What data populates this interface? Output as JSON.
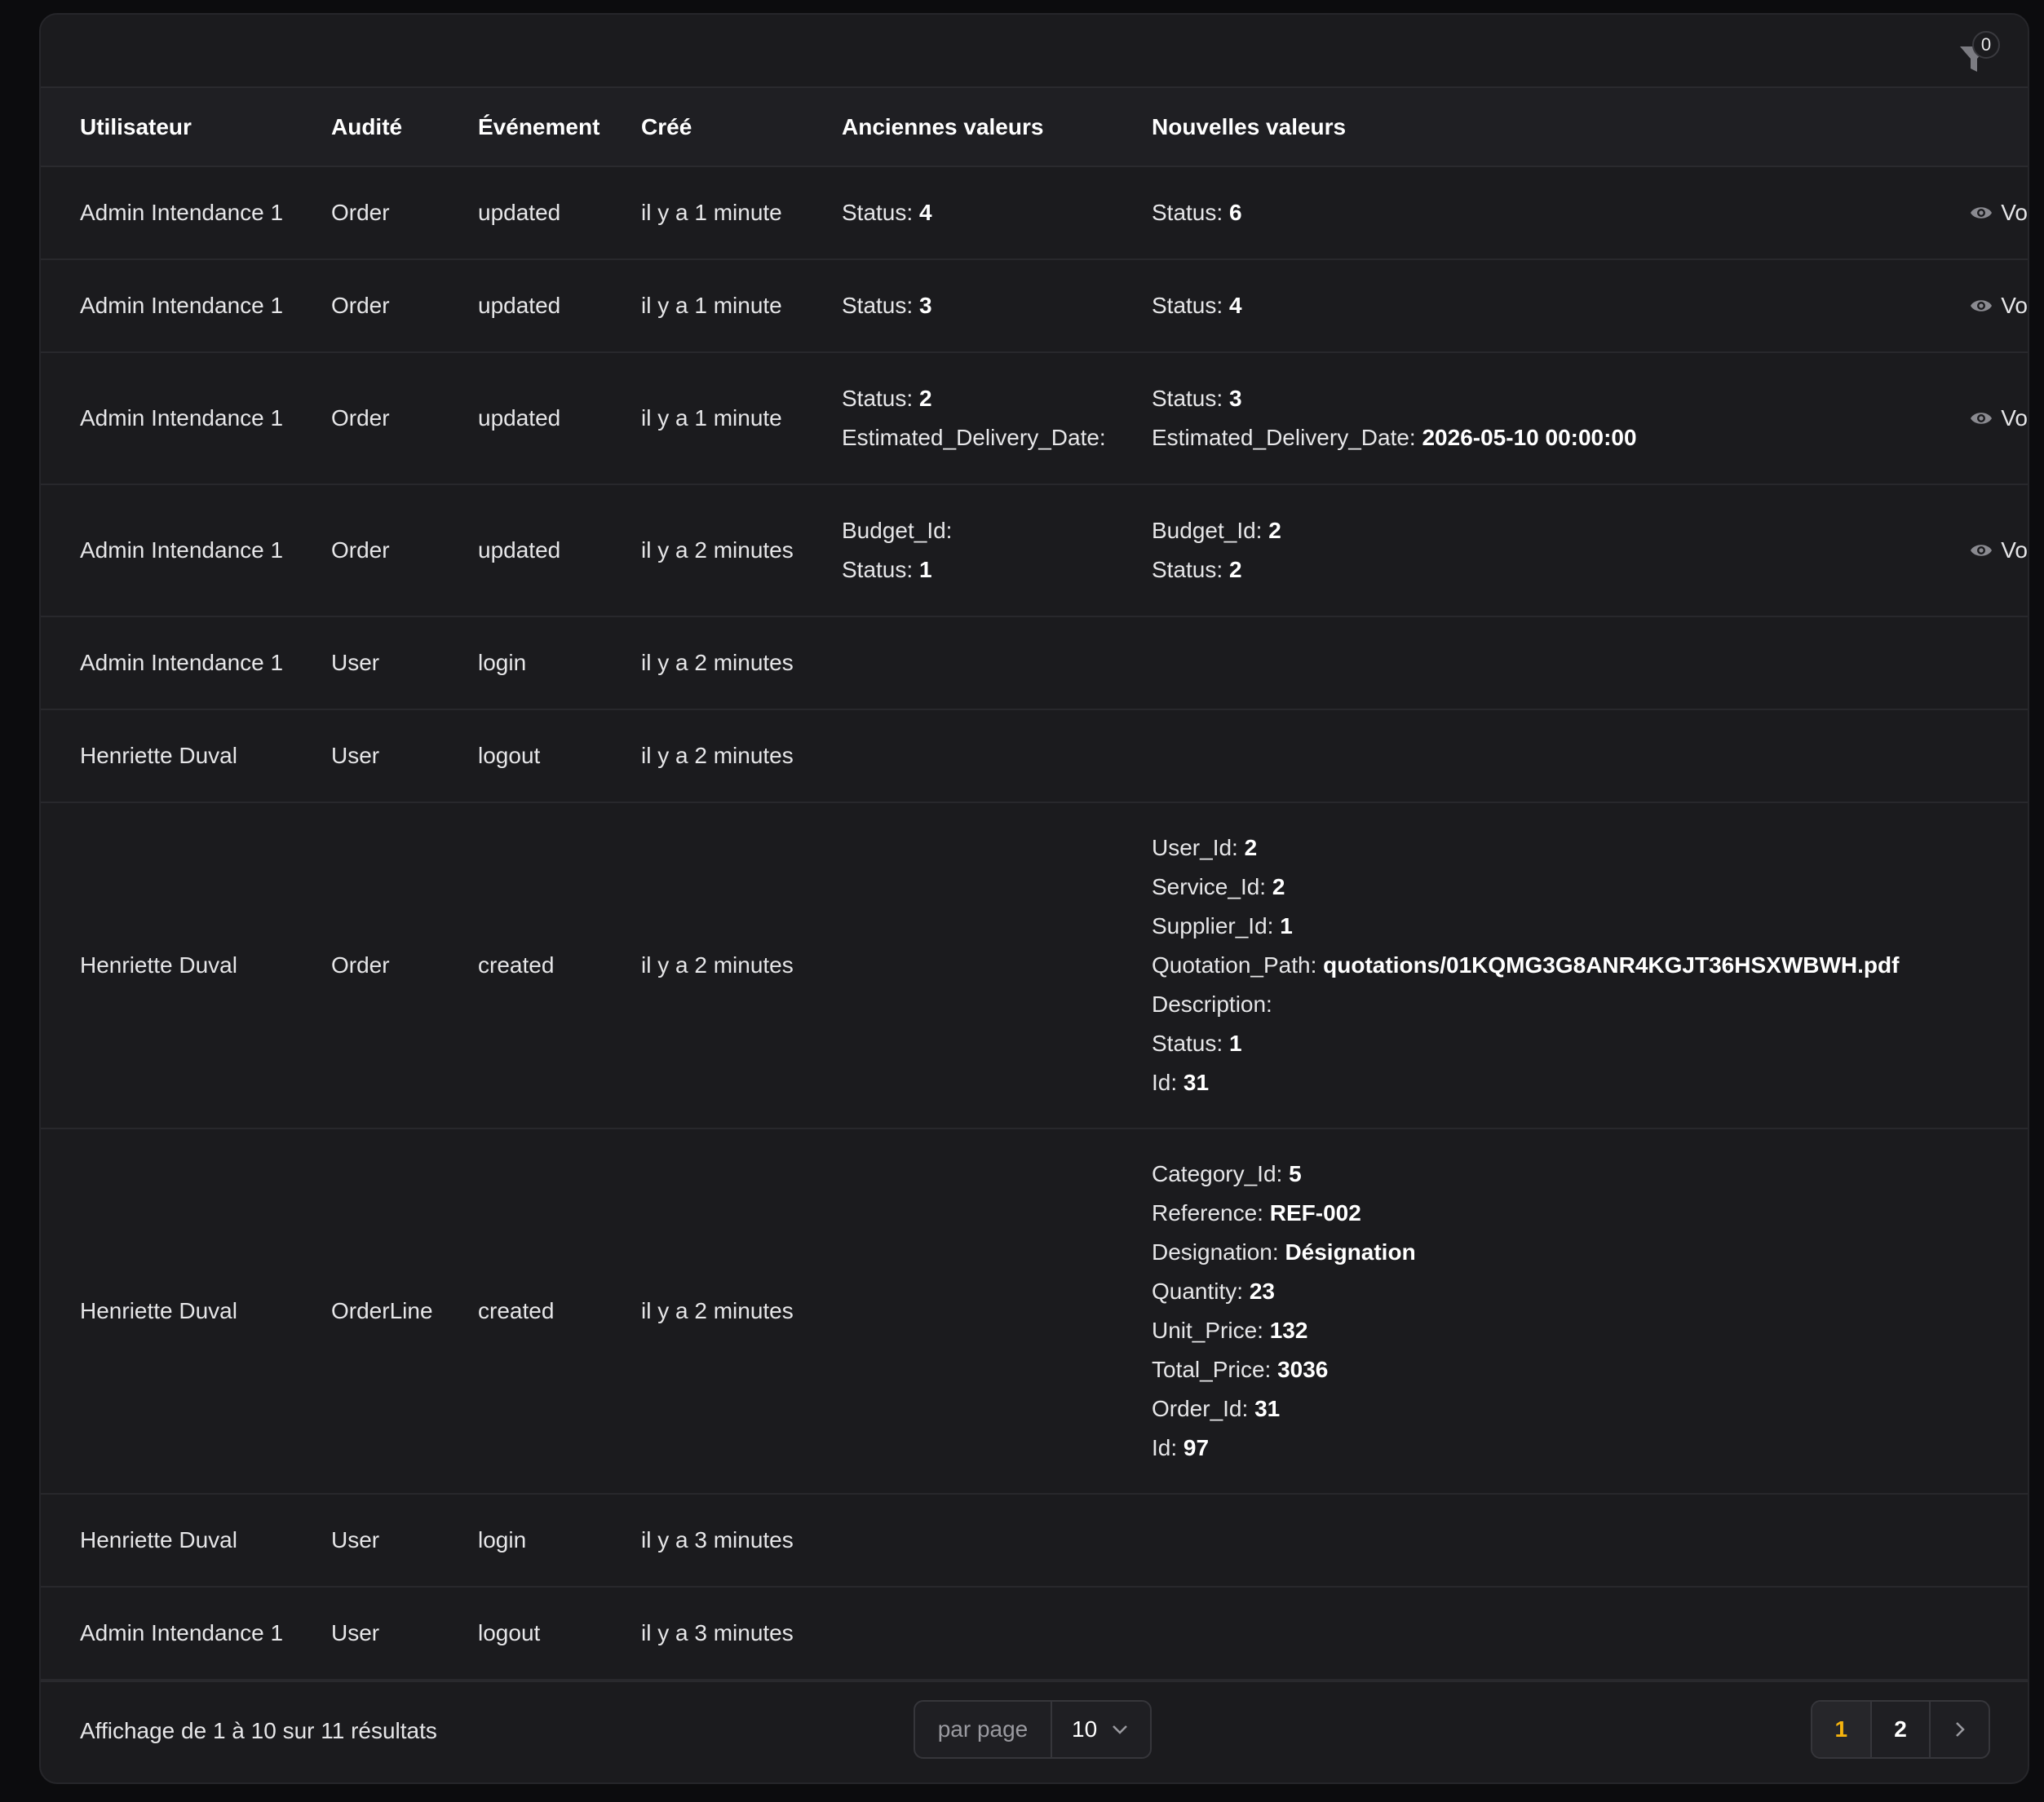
{
  "colors": {
    "accent": "#f5b30e",
    "background": "#1b1b1e",
    "header": "#1f1f23"
  },
  "filter": {
    "icon": "filter-icon",
    "count": "0"
  },
  "columns": [
    "Utilisateur",
    "Audité",
    "Événement",
    "Créé",
    "Anciennes valeurs",
    "Nouvelles valeurs"
  ],
  "view_label": "Vo",
  "rows": [
    {
      "user": "Admin Intendance 1",
      "audited": "Order",
      "event": "updated",
      "created": "il y a 1 minute",
      "old": [
        {
          "k": "Status:",
          "v": "4"
        }
      ],
      "new": [
        {
          "k": "Status:",
          "v": "6"
        }
      ],
      "view": true
    },
    {
      "user": "Admin Intendance 1",
      "audited": "Order",
      "event": "updated",
      "created": "il y a 1 minute",
      "old": [
        {
          "k": "Status:",
          "v": "3"
        }
      ],
      "new": [
        {
          "k": "Status:",
          "v": "4"
        }
      ],
      "view": true
    },
    {
      "user": "Admin Intendance 1",
      "audited": "Order",
      "event": "updated",
      "created": "il y a 1 minute",
      "old": [
        {
          "k": "Status:",
          "v": "2"
        },
        {
          "k": "Estimated_Delivery_Date:",
          "v": ""
        }
      ],
      "new": [
        {
          "k": "Status:",
          "v": "3"
        },
        {
          "k": "Estimated_Delivery_Date:",
          "v": "2026-05-10 00:00:00"
        }
      ],
      "view": true
    },
    {
      "user": "Admin Intendance 1",
      "audited": "Order",
      "event": "updated",
      "created": "il y a 2 minutes",
      "old": [
        {
          "k": "Budget_Id:",
          "v": ""
        },
        {
          "k": "Status:",
          "v": "1"
        }
      ],
      "new": [
        {
          "k": "Budget_Id:",
          "v": "2"
        },
        {
          "k": "Status:",
          "v": "2"
        }
      ],
      "view": true
    },
    {
      "user": "Admin Intendance 1",
      "audited": "User",
      "event": "login",
      "created": "il y a 2 minutes",
      "old": [],
      "new": [],
      "view": false
    },
    {
      "user": "Henriette Duval",
      "audited": "User",
      "event": "logout",
      "created": "il y a 2 minutes",
      "old": [],
      "new": [],
      "view": false
    },
    {
      "user": "Henriette Duval",
      "audited": "Order",
      "event": "created",
      "created": "il y a 2 minutes",
      "old": [],
      "new": [
        {
          "k": "User_Id:",
          "v": "2"
        },
        {
          "k": "Service_Id:",
          "v": "2"
        },
        {
          "k": "Supplier_Id:",
          "v": "1"
        },
        {
          "k": "Quotation_Path:",
          "v": "quotations/01KQMG3G8ANR4KGJT36HSXWBWH.pdf"
        },
        {
          "k": "Description:",
          "v": ""
        },
        {
          "k": "Status:",
          "v": "1"
        },
        {
          "k": "Id:",
          "v": "31"
        }
      ],
      "view": false
    },
    {
      "user": "Henriette Duval",
      "audited": "OrderLine",
      "event": "created",
      "created": "il y a 2 minutes",
      "old": [],
      "new": [
        {
          "k": "Category_Id:",
          "v": "5"
        },
        {
          "k": "Reference:",
          "v": "REF-002"
        },
        {
          "k": "Designation:",
          "v": "Désignation"
        },
        {
          "k": "Quantity:",
          "v": "23"
        },
        {
          "k": "Unit_Price:",
          "v": "132"
        },
        {
          "k": "Total_Price:",
          "v": "3036"
        },
        {
          "k": "Order_Id:",
          "v": "31"
        },
        {
          "k": "Id:",
          "v": "97"
        }
      ],
      "view": false
    },
    {
      "user": "Henriette Duval",
      "audited": "User",
      "event": "login",
      "created": "il y a 3 minutes",
      "old": [],
      "new": [],
      "view": false
    },
    {
      "user": "Admin Intendance 1",
      "audited": "User",
      "event": "logout",
      "created": "il y a 3 minutes",
      "old": [],
      "new": [],
      "view": false
    }
  ],
  "footer": {
    "results": "Affichage de 1 à 10 sur 11 résultats",
    "per_page_label": "par page",
    "per_page_value": "10",
    "pages": [
      "1",
      "2"
    ],
    "current_page": "1"
  }
}
